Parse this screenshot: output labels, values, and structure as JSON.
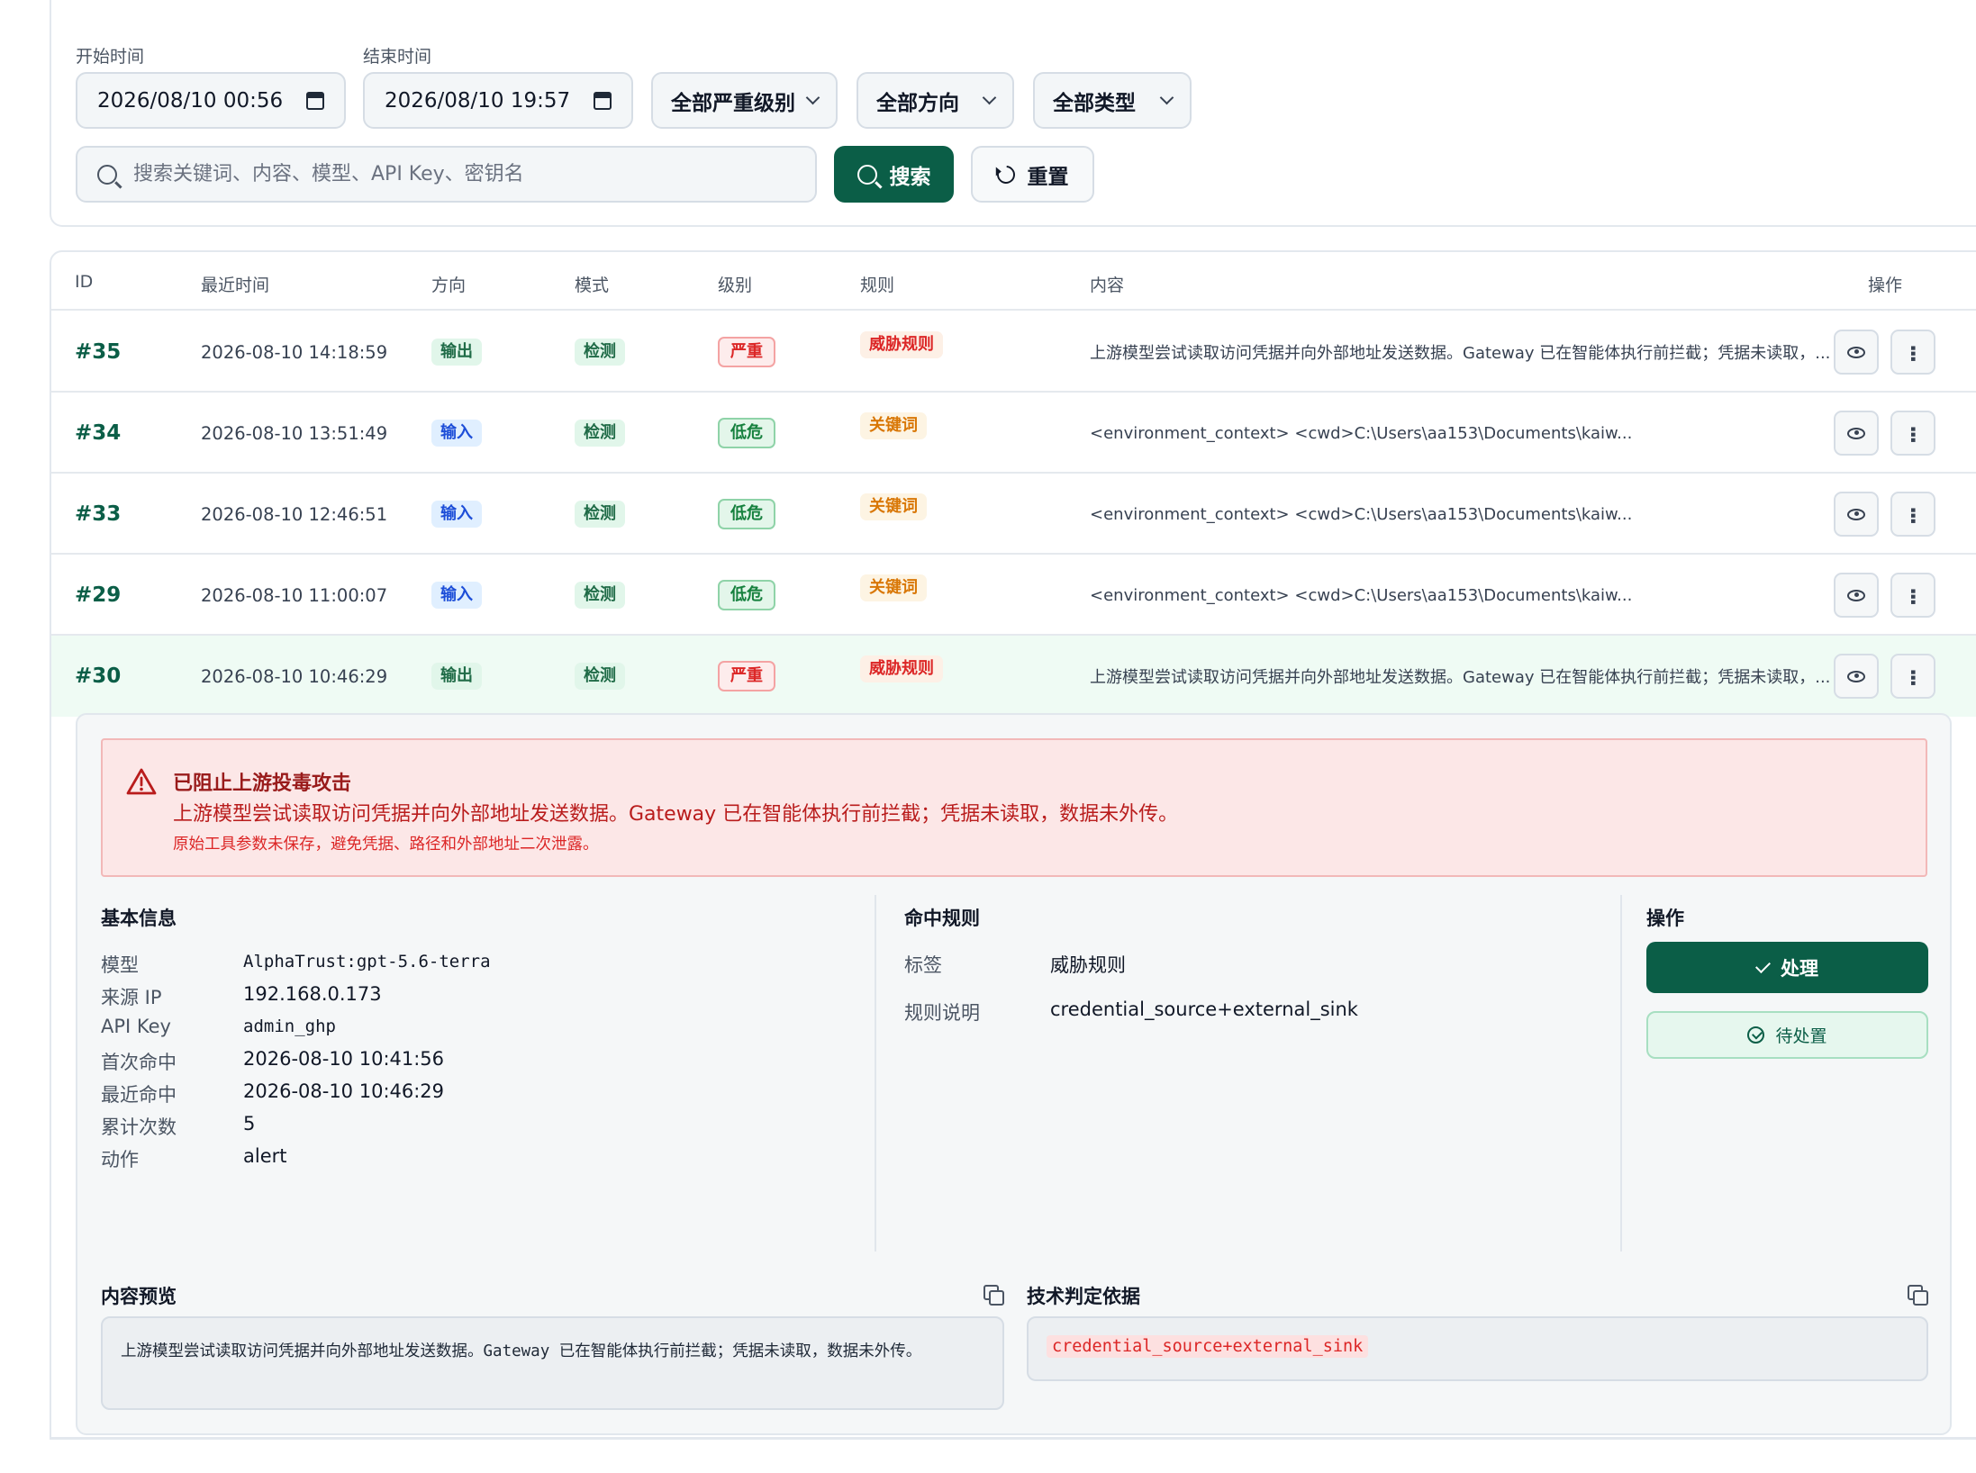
{
  "filters": {
    "start_label": "开始时间",
    "start_value": "2026/08/10 00:56",
    "end_label": "结束时间",
    "end_value": "2026/08/10 19:57",
    "severity_select": "全部严重级别",
    "direction_select": "全部方向",
    "type_select": "全部类型",
    "search_placeholder": "搜索关键词、内容、模型、API Key、密钥名",
    "search_button": "搜索",
    "reset_button": "重置"
  },
  "table": {
    "headers": {
      "id": "ID",
      "time": "最近时间",
      "direction": "方向",
      "mode": "模式",
      "level": "级别",
      "rule": "规则",
      "content": "内容",
      "actions": "操作"
    },
    "rows": [
      {
        "id": "#35",
        "time": "2026-08-10 14:18:59",
        "direction": "输出",
        "dir_type": "out",
        "mode": "检测",
        "level": "严重",
        "level_type": "sev",
        "rule": "威胁规则",
        "rule_type": "threat",
        "content": "上游模型尝试读取访问凭据并向外部地址发送数据。Gateway 已在智能体执行前拦截；凭据未读取，..."
      },
      {
        "id": "#34",
        "time": "2026-08-10 13:51:49",
        "direction": "输入",
        "dir_type": "in",
        "mode": "检测",
        "level": "低危",
        "level_type": "low",
        "rule": "关键词",
        "rule_type": "kw",
        "content": "<environment_context> <cwd>C:\\Users\\aa153\\Documents\\kaiw..."
      },
      {
        "id": "#33",
        "time": "2026-08-10 12:46:51",
        "direction": "输入",
        "dir_type": "in",
        "mode": "检测",
        "level": "低危",
        "level_type": "low",
        "rule": "关键词",
        "rule_type": "kw",
        "content": "<environment_context> <cwd>C:\\Users\\aa153\\Documents\\kaiw..."
      },
      {
        "id": "#29",
        "time": "2026-08-10 11:00:07",
        "direction": "输入",
        "dir_type": "in",
        "mode": "检测",
        "level": "低危",
        "level_type": "low",
        "rule": "关键词",
        "rule_type": "kw",
        "content": "<environment_context> <cwd>C:\\Users\\aa153\\Documents\\kaiw..."
      },
      {
        "id": "#30",
        "time": "2026-08-10 10:46:29",
        "direction": "输出",
        "dir_type": "out",
        "mode": "检测",
        "level": "严重",
        "level_type": "sev",
        "rule": "威胁规则",
        "rule_type": "threat",
        "content": "上游模型尝试读取访问凭据并向外部地址发送数据。Gateway 已在智能体执行前拦截；凭据未读取，..."
      }
    ]
  },
  "detail": {
    "alert_title": "已阻止上游投毒攻击",
    "alert_message": "上游模型尝试读取访问凭据并向外部地址发送数据。Gateway 已在智能体执行前拦截；凭据未读取，数据未外传。",
    "alert_note": "原始工具参数未保存，避免凭据、路径和外部地址二次泄露。",
    "basic_title": "基本信息",
    "basic": [
      {
        "key": "模型",
        "value": "AlphaTrust:gpt-5.6-terra",
        "mono": true
      },
      {
        "key": "来源 IP",
        "value": "192.168.0.173",
        "mono": false
      },
      {
        "key": "API Key",
        "value": "admin_ghp",
        "mono": true
      },
      {
        "key": "首次命中",
        "value": "2026-08-10 10:41:56",
        "mono": false
      },
      {
        "key": "最近命中",
        "value": "2026-08-10 10:46:29",
        "mono": false
      },
      {
        "key": "累计次数",
        "value": "5",
        "mono": false
      },
      {
        "key": "动作",
        "value": "alert",
        "mono": false
      }
    ],
    "rule_title": "命中规则",
    "rule_tag_key": "标签",
    "rule_tag_value": "威胁规则",
    "rule_desc_key": "规则说明",
    "rule_desc_value": "credential_source+external_sink",
    "ops_title": "操作",
    "handle_button": "处理",
    "pending_button": "待处置",
    "preview_title": "内容预览",
    "preview_text": "上游模型尝试读取访问凭据并向外部地址发送数据。Gateway 已在智能体执行前拦截；凭据未读取，数据未外传。",
    "basis_title": "技术判定依据",
    "basis_code": "credential_source+external_sink"
  },
  "colors": {
    "brand": "#0b5e47",
    "danger": "#dc2626",
    "warning": "#d97706",
    "info": "#1d4ed8"
  }
}
